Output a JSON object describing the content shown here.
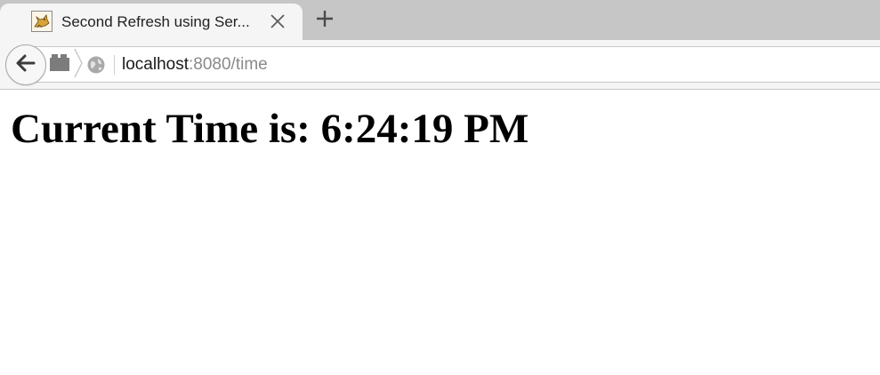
{
  "tab": {
    "title": "Second Refresh using Ser...",
    "favicon": "tomcat-icon"
  },
  "toolbar": {
    "close_tab_icon": "close-icon",
    "new_tab_icon": "plus-icon",
    "back_icon": "back-arrow-icon",
    "identity_icon": "site-identity-icon",
    "globe_icon": "globe-icon"
  },
  "url": {
    "host": "localhost",
    "rest": ":8080/time"
  },
  "page": {
    "heading": "Current Time is: 6:24:19 PM"
  }
}
